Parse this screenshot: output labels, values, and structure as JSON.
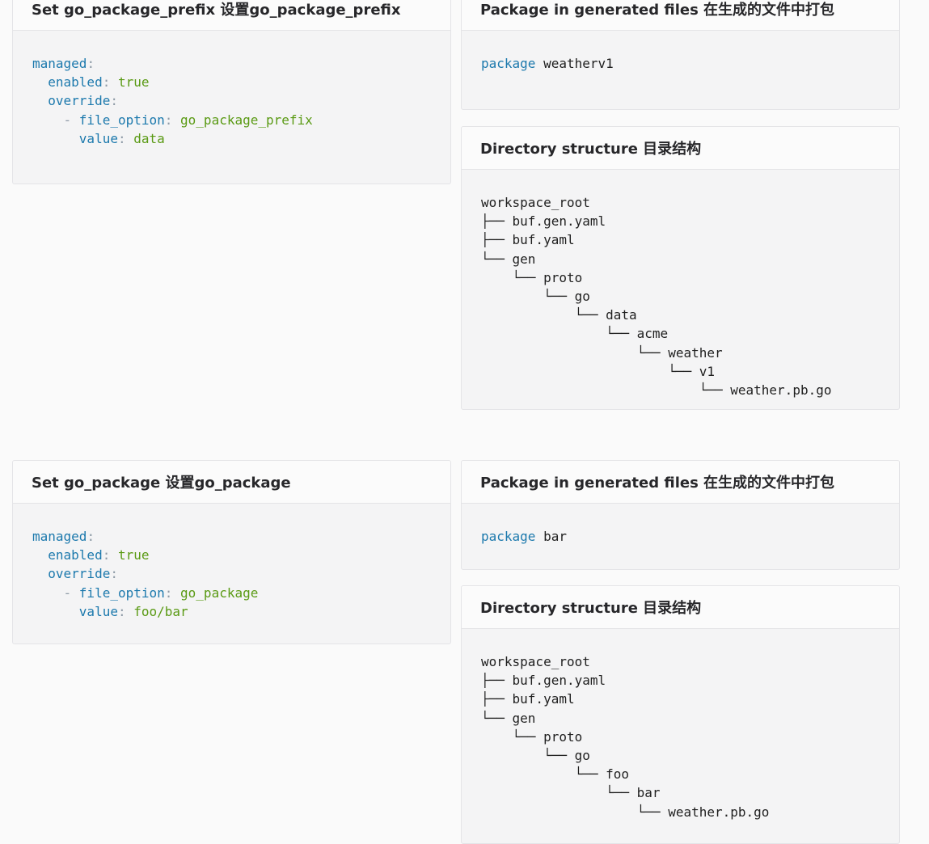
{
  "sections": [
    {
      "config": {
        "title": "Set go_package_prefix 设置go_package_prefix",
        "lines": [
          {
            "key": "managed"
          },
          {
            "key": "enabled",
            "value": "true"
          },
          {
            "key": "override"
          },
          {
            "key": "file_option",
            "value": "go_package_prefix"
          },
          {
            "key": "value",
            "value": "data"
          }
        ]
      },
      "package": {
        "title": "Package in generated files 在生成的文件中打包",
        "keyword": "package",
        "name": "weatherv1"
      },
      "directory": {
        "title": "Directory structure 目录结构",
        "lines": [
          "workspace_root",
          "├── buf.gen.yaml",
          "├── buf.yaml",
          "└── gen",
          "    └── proto",
          "        └── go",
          "            └── data",
          "                └── acme",
          "                    └── weather",
          "                        └── v1",
          "                            └── weather.pb.go"
        ]
      }
    },
    {
      "config": {
        "title": "Set go_package 设置go_package",
        "lines": [
          {
            "key": "managed"
          },
          {
            "key": "enabled",
            "value": "true"
          },
          {
            "key": "override"
          },
          {
            "key": "file_option",
            "value": "go_package"
          },
          {
            "key": "value",
            "value": "foo/bar"
          }
        ]
      },
      "package": {
        "title": "Package in generated files 在生成的文件中打包",
        "keyword": "package",
        "name": "bar"
      },
      "directory": {
        "title": "Directory structure 目录结构",
        "lines": [
          "workspace_root",
          "├── buf.gen.yaml",
          "├── buf.yaml",
          "└── gen",
          "    └── proto",
          "        └── go",
          "            └── foo",
          "                └── bar",
          "                    └── weather.pb.go"
        ]
      }
    }
  ]
}
